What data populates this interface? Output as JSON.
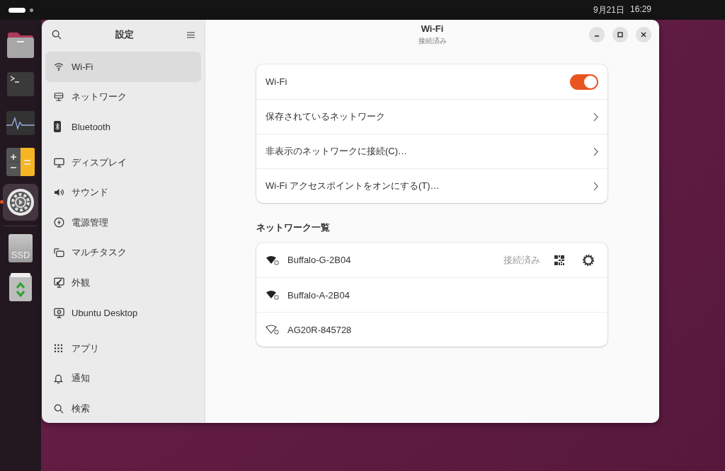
{
  "top_bar": {
    "date": "9月21日",
    "time": "16:29"
  },
  "dock": {
    "items": [
      {
        "kind": "files",
        "running": false
      },
      {
        "kind": "terminal",
        "running": false
      },
      {
        "kind": "monitor",
        "running": false
      },
      {
        "kind": "calculator",
        "running": false
      },
      {
        "kind": "settings",
        "running": true
      },
      {
        "kind": "drive",
        "label": "SSD",
        "running": false
      },
      {
        "kind": "trash",
        "running": false
      }
    ]
  },
  "sidebar": {
    "title": "設定",
    "groups": [
      {
        "items": [
          {
            "label": "Wi-Fi",
            "kind": "wifi",
            "selected": true
          },
          {
            "label": "ネットワーク",
            "kind": "network",
            "selected": false
          },
          {
            "label": "Bluetooth",
            "kind": "bluetooth",
            "selected": false
          }
        ]
      },
      {
        "items": [
          {
            "label": "ディスプレイ",
            "kind": "display",
            "selected": false
          },
          {
            "label": "サウンド",
            "kind": "sound",
            "selected": false
          },
          {
            "label": "電源管理",
            "kind": "power",
            "selected": false
          },
          {
            "label": "マルチタスク",
            "kind": "multitask",
            "selected": false
          },
          {
            "label": "外観",
            "kind": "appearance",
            "selected": false
          },
          {
            "label": "Ubuntu Desktop",
            "kind": "desktop",
            "selected": false
          }
        ]
      },
      {
        "items": [
          {
            "label": "アプリ",
            "kind": "apps",
            "selected": false
          },
          {
            "label": "通知",
            "kind": "bell",
            "selected": false
          },
          {
            "label": "検索",
            "kind": "search",
            "selected": false
          }
        ]
      }
    ]
  },
  "header": {
    "title": "Wi-Fi",
    "subtitle": "接続済み"
  },
  "wifi_card": {
    "rows": [
      {
        "kind": "switch",
        "label": "Wi-Fi",
        "on": true
      },
      {
        "kind": "link",
        "label": "保存されているネットワーク"
      },
      {
        "kind": "link",
        "label": "非表示のネットワークに接続(C)…"
      },
      {
        "kind": "link",
        "label": "Wi-Fi アクセスポイントをオンにする(T)…"
      }
    ]
  },
  "networks": {
    "heading": "ネットワーク一覧",
    "items": [
      {
        "name": "Buffalo-G-2B04",
        "kind": "strong",
        "connected": true,
        "status": "接続済み"
      },
      {
        "name": "Buffalo-A-2B04",
        "kind": "strong",
        "connected": false
      },
      {
        "name": "AG20R-845728",
        "kind": "none",
        "connected": false
      }
    ]
  }
}
